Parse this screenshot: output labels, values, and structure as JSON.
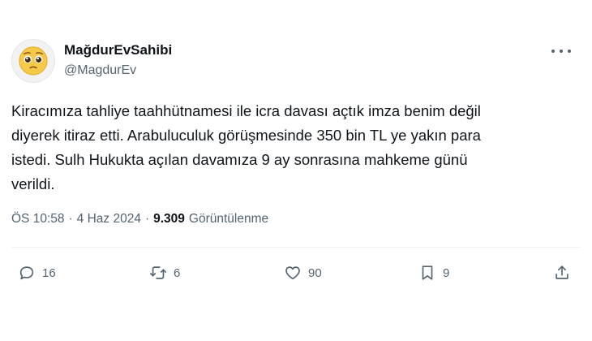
{
  "author": {
    "display_name": "MağdurEvSahibi",
    "handle": "@MagdurEv",
    "avatar_icon": "pleading-face-emoji"
  },
  "tweet": {
    "text": "Kiracımıza tahliye taahhütnamesi ile icra davası açtık imza benim değil\ndiyerek itiraz etti. Arabuluculuk görüşmesinde 350 bin TL ye yakın para\nistedi. Sulh Hukukta açılan davamıza 9 ay sonrasına mahkeme günü\nverildi.",
    "time": "ÖS 10:58",
    "date": "4 Haz 2024",
    "separator": "·",
    "views_count": "9.309",
    "views_label": "Görüntülenme"
  },
  "actions": {
    "reply_count": "16",
    "retweet_count": "6",
    "like_count": "90",
    "bookmark_count": "9"
  },
  "colors": {
    "text": "#0f1419",
    "secondary": "#536471",
    "divider": "#eff3f4"
  }
}
